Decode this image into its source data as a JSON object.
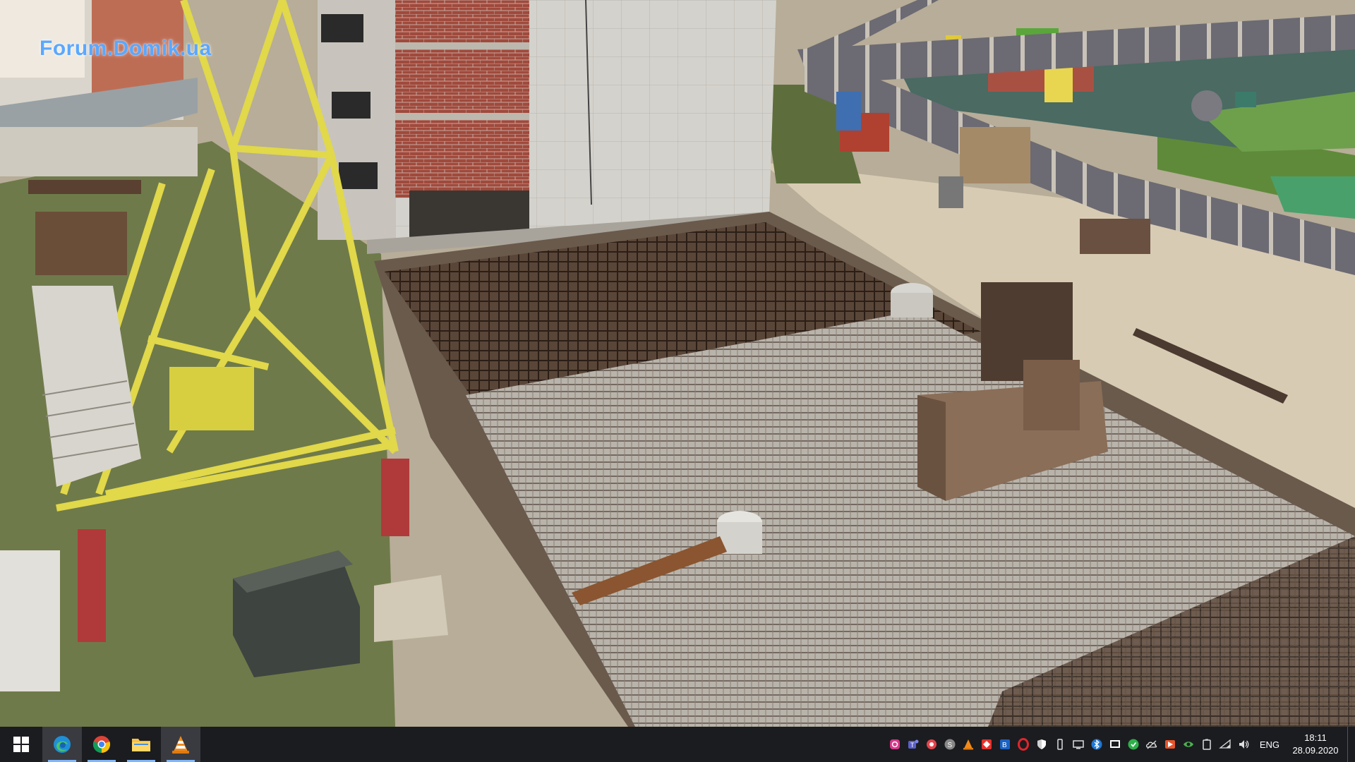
{
  "video": {
    "watermark": "Forum.Domik.ua"
  },
  "taskbar": {
    "pinned": [
      {
        "name": "start-button",
        "icon": "windows-logo-icon"
      },
      {
        "name": "edge-button",
        "icon": "edge-icon",
        "running": true,
        "active": true
      },
      {
        "name": "chrome-button",
        "icon": "chrome-icon",
        "running": true
      },
      {
        "name": "file-explorer-button",
        "icon": "folder-icon",
        "running": true
      },
      {
        "name": "vlc-button",
        "icon": "vlc-cone-icon",
        "running": true,
        "active": true
      }
    ],
    "tray_icons": [
      "instagram-icon",
      "teams-icon",
      "cloud-sync-icon",
      "skype-icon",
      "vlc-tray-icon",
      "anydesk-icon",
      "bitwarden-icon",
      "opera-icon",
      "defender-shield-icon",
      "usb-icon",
      "display-icon",
      "bluetooth-icon",
      "monitor-icon",
      "update-icon",
      "onedrive-icon",
      "nvidia-icon",
      "eye-icon",
      "battery-icon",
      "wifi-icon",
      "volume-icon"
    ],
    "language": "ENG",
    "time": "18:11",
    "date": "28.09.2020"
  },
  "colors": {
    "taskbar_bg": "#1b1c20",
    "accent": "#7fb6ff",
    "watermark": "#5aa8ff"
  }
}
